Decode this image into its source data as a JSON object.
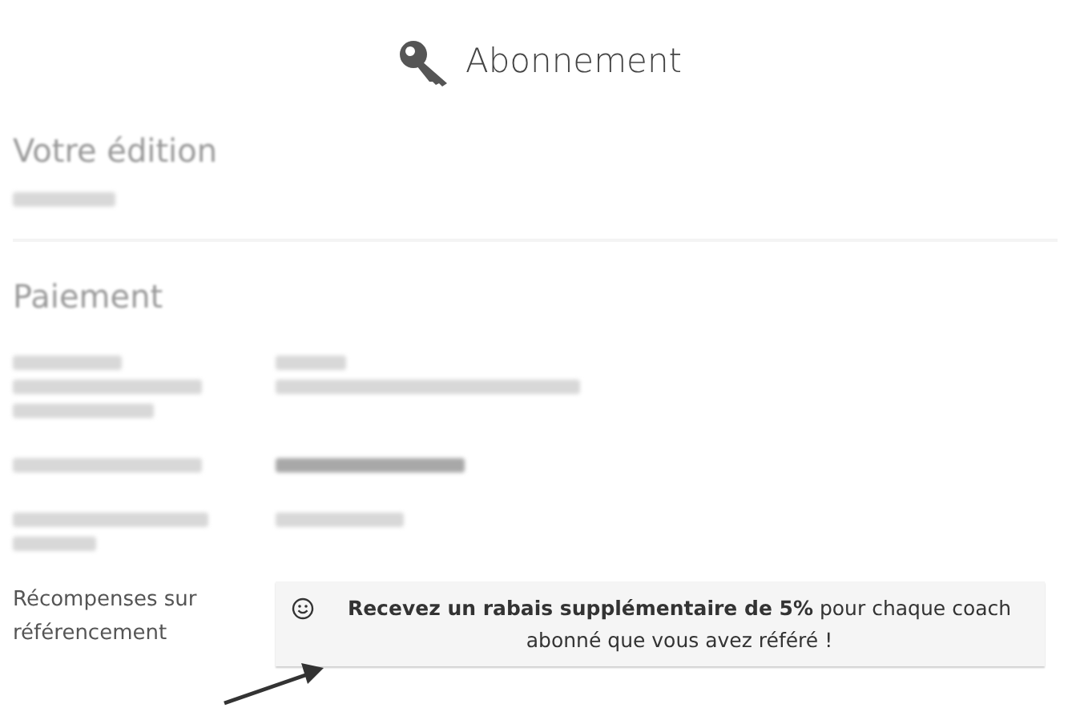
{
  "title": "Abonnement",
  "edition": {
    "heading": "Votre édition",
    "value": {
      "kind": "redacted"
    }
  },
  "payment": {
    "heading": "Paiement",
    "rows": [
      {
        "label": {
          "kind": "redacted"
        },
        "value": {
          "kind": "redacted"
        }
      },
      {
        "label": {
          "kind": "redacted"
        },
        "value": {
          "kind": "redacted"
        }
      },
      {
        "label": {
          "kind": "redacted"
        },
        "value": {
          "kind": "redacted"
        }
      },
      {
        "label": {
          "kind": "text",
          "text": "Récompenses sur référencement"
        },
        "value": {
          "kind": "callout",
          "text": "**Recevez un rabais supplémentaire de 5%** pour chaque coach abonné que vous avez référé !"
        }
      }
    ]
  }
}
